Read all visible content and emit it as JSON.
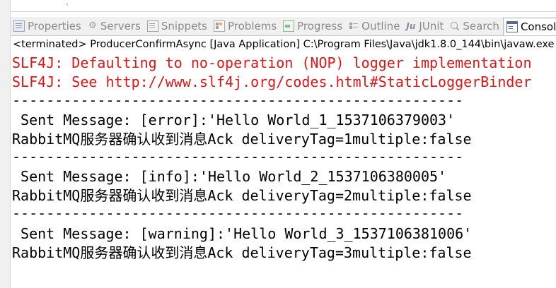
{
  "tabs": [
    {
      "id": "properties",
      "label": "Properties",
      "icon": "properties-icon"
    },
    {
      "id": "servers",
      "label": "Servers",
      "icon": "servers-icon"
    },
    {
      "id": "snippets",
      "label": "Snippets",
      "icon": "snippets-icon"
    },
    {
      "id": "problems",
      "label": "Problems",
      "icon": "problems-icon"
    },
    {
      "id": "progress",
      "label": "Progress",
      "icon": "progress-icon"
    },
    {
      "id": "outline",
      "label": "Outline",
      "icon": "outline-icon"
    },
    {
      "id": "junit",
      "label": "JUnit",
      "icon": "junit-icon"
    },
    {
      "id": "search",
      "label": "Search",
      "icon": "search-icon"
    },
    {
      "id": "console",
      "label": "Console",
      "icon": "console-icon",
      "active": true
    }
  ],
  "status_line": "<terminated> ProducerConfirmAsync [Java Application] C:\\Program Files\\Java\\jdk1.8.0_144\\bin\\javaw.exe",
  "console_lines": [
    {
      "text": "SLF4J: Defaulting to no-operation (NOP) logger implementation",
      "type": "error"
    },
    {
      "text": "SLF4J: See http://www.slf4j.org/codes.html#StaticLoggerBinder",
      "type": "error"
    },
    {
      "text": "-----------------------------------------------------",
      "type": "normal"
    },
    {
      "text": " Sent Message: [error]:'Hello World_1_1537106379003'",
      "type": "normal"
    },
    {
      "text": "RabbitMQ服务器确认收到消息Ack deliveryTag=1multiple:false",
      "type": "normal"
    },
    {
      "text": "-----------------------------------------------------",
      "type": "normal"
    },
    {
      "text": " Sent Message: [info]:'Hello World_2_1537106380005'",
      "type": "normal"
    },
    {
      "text": "RabbitMQ服务器确认收到消息Ack deliveryTag=2multiple:false",
      "type": "normal"
    },
    {
      "text": "-----------------------------------------------------",
      "type": "normal"
    },
    {
      "text": " Sent Message: [warning]:'Hello World_3_1537106381006'",
      "type": "normal"
    },
    {
      "text": "RabbitMQ服务器确认收到消息Ack deliveryTag=3multiple:false",
      "type": "normal"
    }
  ],
  "colors": {
    "error_text": "#e01515",
    "normal_text": "#000000",
    "tab_inactive": "#8a8a8a"
  }
}
